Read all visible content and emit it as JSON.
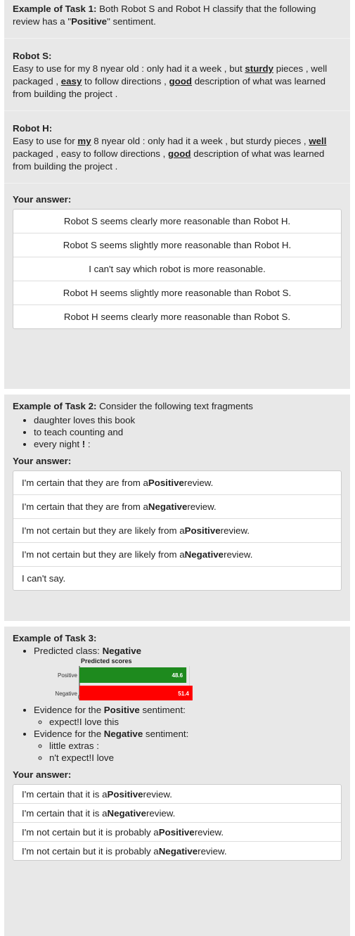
{
  "task1": {
    "heading": "Example of Task 1:",
    "intro_a": " Both Robot S and Robot H classify that the following review has a \"",
    "intro_b": "Positive",
    "intro_c": "\" sentiment.",
    "robot_s": {
      "name": "Robot S:",
      "t1": "Easy to use for my 8 nyear old : only had it a week , but ",
      "h1": "sturdy",
      "t2": " pieces , well packaged , ",
      "h2": "easy",
      "t3": " to follow directions , ",
      "h3": "good",
      "t4": " description of what was learned from building the project ."
    },
    "robot_h": {
      "name": "Robot H:",
      "t1": "Easy to use for ",
      "h1": "my",
      "t2": " 8 nyear old : only had it a week , but sturdy pieces , ",
      "h2": "well",
      "t3": " packaged , easy to follow directions , ",
      "h3": "good",
      "t4": " description of what was learned from building the project ."
    },
    "answer_label": "Your answer:",
    "options": [
      "Robot S seems clearly more reasonable than Robot H.",
      "Robot S seems slightly more reasonable than Robot H.",
      "I can't say which robot is more reasonable.",
      "Robot H seems slightly more reasonable than Robot S.",
      "Robot H seems clearly more reasonable than Robot S."
    ]
  },
  "task2": {
    "heading": "Example of Task 2:",
    "intro": " Consider the following text fragments",
    "fragments": [
      "daughter loves this book",
      "to teach counting and",
      "every night "
    ],
    "frag3_bold": "!",
    "frag3_tail": " :",
    "answer_label": "Your answer:",
    "options": [
      {
        "pre": "I'm certain that they are from a ",
        "b": "Positive",
        "post": " review."
      },
      {
        "pre": "I'm certain that they are from a ",
        "b": "Negative",
        "post": " review."
      },
      {
        "pre": "I'm not certain but they are likely from a ",
        "b": "Positive",
        "post": " review."
      },
      {
        "pre": "I'm not certain but they are likely from a ",
        "b": "Negative",
        "post": " review."
      },
      {
        "pre": "I can't say.",
        "b": "",
        "post": ""
      }
    ]
  },
  "task3": {
    "heading": "Example of Task 3:",
    "pred_label": "Predicted class: ",
    "pred_value": "Negative",
    "ev_pos_pre": "Evidence for the ",
    "ev_pos_b": "Positive",
    "ev_pos_post": " sentiment:",
    "ev_pos_items": [
      "expect!I love this"
    ],
    "ev_neg_pre": "Evidence for the ",
    "ev_neg_b": "Negative",
    "ev_neg_post": " sentiment:",
    "ev_neg_items": [
      "little extras :",
      "n't expect!I love"
    ],
    "answer_label": "Your answer:",
    "options": [
      {
        "pre": "I'm certain that it is a ",
        "b": "Positive",
        "post": " review."
      },
      {
        "pre": "I'm certain that it is a ",
        "b": "Negative",
        "post": " review."
      },
      {
        "pre": "I'm not certain but it is probably a ",
        "b": "Positive",
        "post": " review."
      },
      {
        "pre": "I'm not certain but it is probably a ",
        "b": "Negative",
        "post": " review."
      }
    ]
  },
  "chart_data": {
    "type": "bar",
    "title": "Predicted scores",
    "categories": [
      "Positive",
      "Negative"
    ],
    "values": [
      48.6,
      51.4
    ],
    "colors": [
      "#1e8a1e",
      "#ff0000"
    ],
    "xlim": [
      0,
      100
    ],
    "xticks": [
      "0",
      "50",
      "100"
    ],
    "orientation": "horizontal",
    "grid": true
  }
}
